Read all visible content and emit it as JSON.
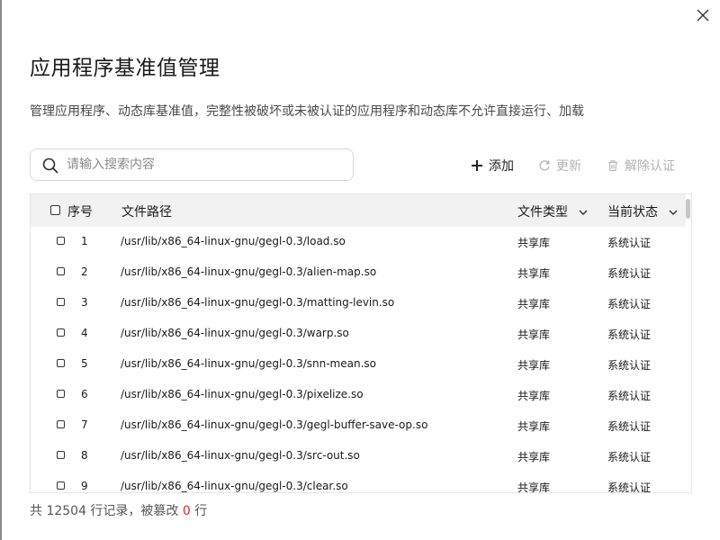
{
  "dialog": {
    "title": "应用程序基准值管理",
    "description": "管理应用程序、动态库基准值，完整性被破坏或未被认证的应用程序和动态库不允许直接运行、加载"
  },
  "search": {
    "placeholder": "请输入搜索内容",
    "value": ""
  },
  "toolbar": {
    "add_label": "添加",
    "refresh_label": "更新",
    "unauth_label": "解除认证"
  },
  "table": {
    "headers": {
      "index": "序号",
      "path": "文件路径",
      "type": "文件类型",
      "status": "当前状态"
    },
    "rows": [
      {
        "index": "1",
        "path": "/usr/lib/x86_64-linux-gnu/gegl-0.3/load.so",
        "type": "共享库",
        "status": "系统认证"
      },
      {
        "index": "2",
        "path": "/usr/lib/x86_64-linux-gnu/gegl-0.3/alien-map.so",
        "type": "共享库",
        "status": "系统认证"
      },
      {
        "index": "3",
        "path": "/usr/lib/x86_64-linux-gnu/gegl-0.3/matting-levin.so",
        "type": "共享库",
        "status": "系统认证"
      },
      {
        "index": "4",
        "path": "/usr/lib/x86_64-linux-gnu/gegl-0.3/warp.so",
        "type": "共享库",
        "status": "系统认证"
      },
      {
        "index": "5",
        "path": "/usr/lib/x86_64-linux-gnu/gegl-0.3/snn-mean.so",
        "type": "共享库",
        "status": "系统认证"
      },
      {
        "index": "6",
        "path": "/usr/lib/x86_64-linux-gnu/gegl-0.3/pixelize.so",
        "type": "共享库",
        "status": "系统认证"
      },
      {
        "index": "7",
        "path": "/usr/lib/x86_64-linux-gnu/gegl-0.3/gegl-buffer-save-op.so",
        "type": "共享库",
        "status": "系统认证"
      },
      {
        "index": "8",
        "path": "/usr/lib/x86_64-linux-gnu/gegl-0.3/src-out.so",
        "type": "共享库",
        "status": "系统认证"
      },
      {
        "index": "9",
        "path": "/usr/lib/x86_64-linux-gnu/gegl-0.3/clear.so",
        "type": "共享库",
        "status": "系统认证"
      }
    ]
  },
  "footer": {
    "prefix": "共 12504 行记录，被篡改",
    "tampered_count": "0",
    "suffix": "行"
  },
  "colors": {
    "tampered_count": "#e0281e",
    "disabled_text": "#b3b3b3",
    "header_bg": "#f2f2f2"
  }
}
